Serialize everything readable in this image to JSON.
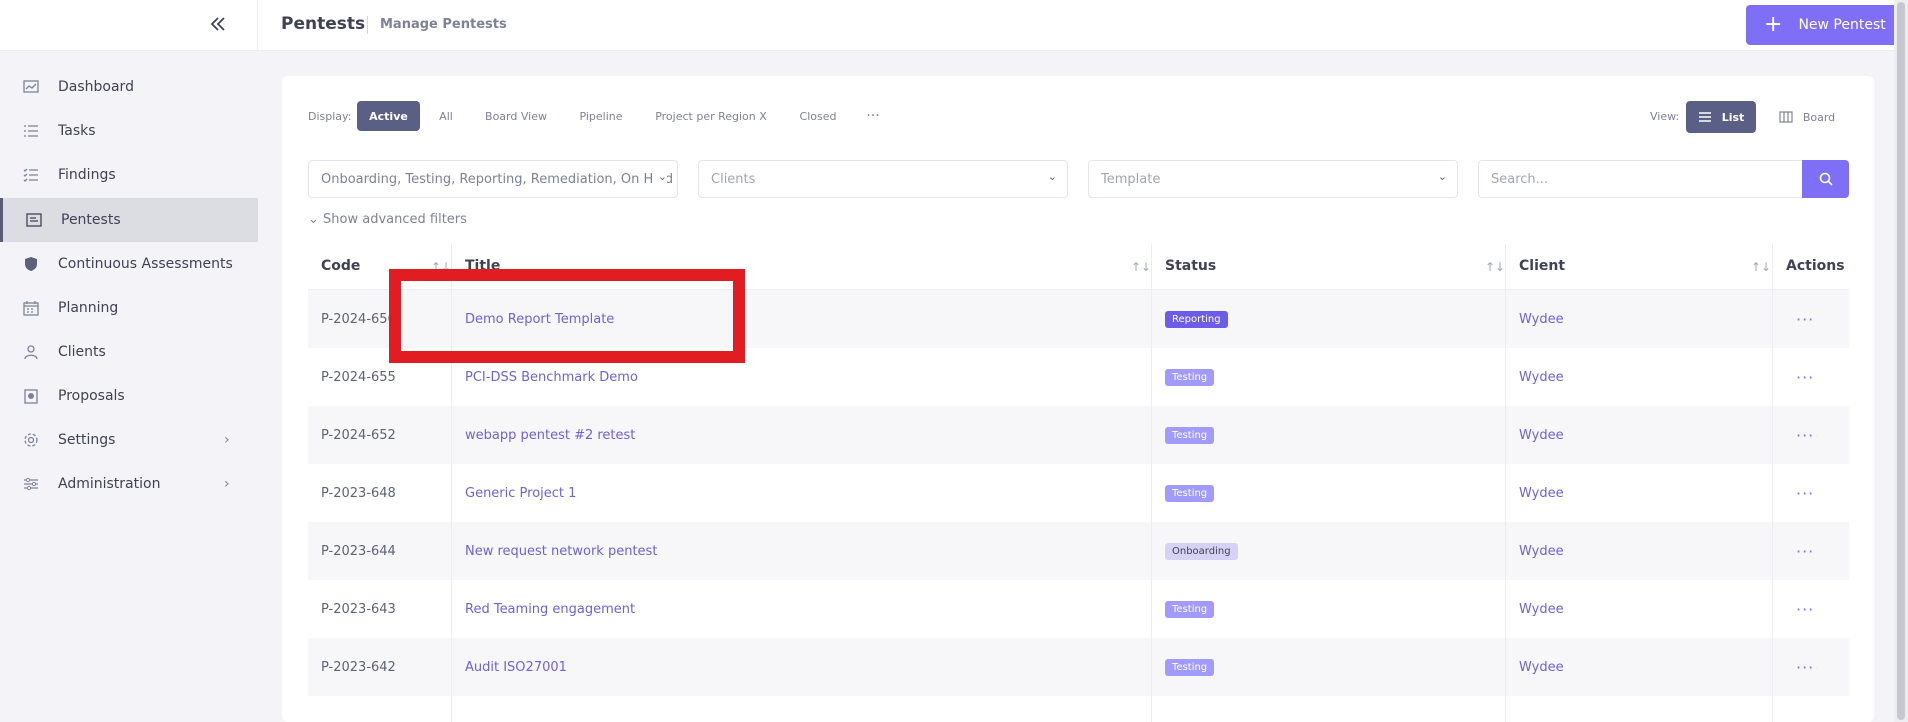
{
  "header": {
    "collapse_icon": "double-chevron-left-icon",
    "title": "Pentests",
    "subtitle": "Manage Pentests",
    "new_button": "New Pentest"
  },
  "sidebar": {
    "items": [
      {
        "label": "Dashboard",
        "icon": "dashboard-icon"
      },
      {
        "label": "Tasks",
        "icon": "tasks-icon"
      },
      {
        "label": "Findings",
        "icon": "findings-icon"
      },
      {
        "label": "Pentests",
        "icon": "pentests-icon",
        "active": true
      },
      {
        "label": "Continuous Assessments",
        "icon": "shield-icon"
      },
      {
        "label": "Planning",
        "icon": "calendar-icon"
      },
      {
        "label": "Clients",
        "icon": "clients-icon"
      },
      {
        "label": "Proposals",
        "icon": "proposals-icon"
      },
      {
        "label": "Settings",
        "icon": "gear-icon",
        "has_children": true
      },
      {
        "label": "Administration",
        "icon": "sliders-icon",
        "has_children": true
      }
    ]
  },
  "display": {
    "label": "Display:",
    "tabs": [
      "Active",
      "All",
      "Board View",
      "Pipeline",
      "Project per Region X",
      "Closed"
    ],
    "more": "···"
  },
  "view": {
    "label": "View:",
    "list": "List",
    "board": "Board"
  },
  "filters": {
    "status_value": "Onboarding, Testing, Reporting, Remediation, On Hold",
    "clients_placeholder": "Clients",
    "template_placeholder": "Template",
    "search_placeholder": "Search...",
    "advanced": "Show advanced filters"
  },
  "table": {
    "headers": {
      "code": "Code",
      "title": "Title",
      "status": "Status",
      "client": "Client",
      "actions": "Actions"
    },
    "rows": [
      {
        "code": "P-2024-656",
        "title": "Demo Report Template",
        "status": "Reporting",
        "client": "Wydee"
      },
      {
        "code": "P-2024-655",
        "title": "PCI-DSS Benchmark Demo",
        "status": "Testing",
        "client": "Wydee"
      },
      {
        "code": "P-2024-652",
        "title": "webapp pentest #2 retest",
        "status": "Testing",
        "client": "Wydee"
      },
      {
        "code": "P-2023-648",
        "title": "Generic Project 1",
        "status": "Testing",
        "client": "Wydee"
      },
      {
        "code": "P-2023-644",
        "title": "New request network pentest",
        "status": "Onboarding",
        "client": "Wydee"
      },
      {
        "code": "P-2023-643",
        "title": "Red Teaming engagement",
        "status": "Testing",
        "client": "Wydee"
      },
      {
        "code": "P-2023-642",
        "title": "Audit ISO27001",
        "status": "Testing",
        "client": "Wydee"
      }
    ],
    "action_glyph": "···"
  },
  "colors": {
    "accent": "#7e6ff6",
    "reporting": "#6c5ce7",
    "testing": "#a29bfe",
    "onboarding": "#d6d2f7",
    "highlight": "#e11d21"
  }
}
